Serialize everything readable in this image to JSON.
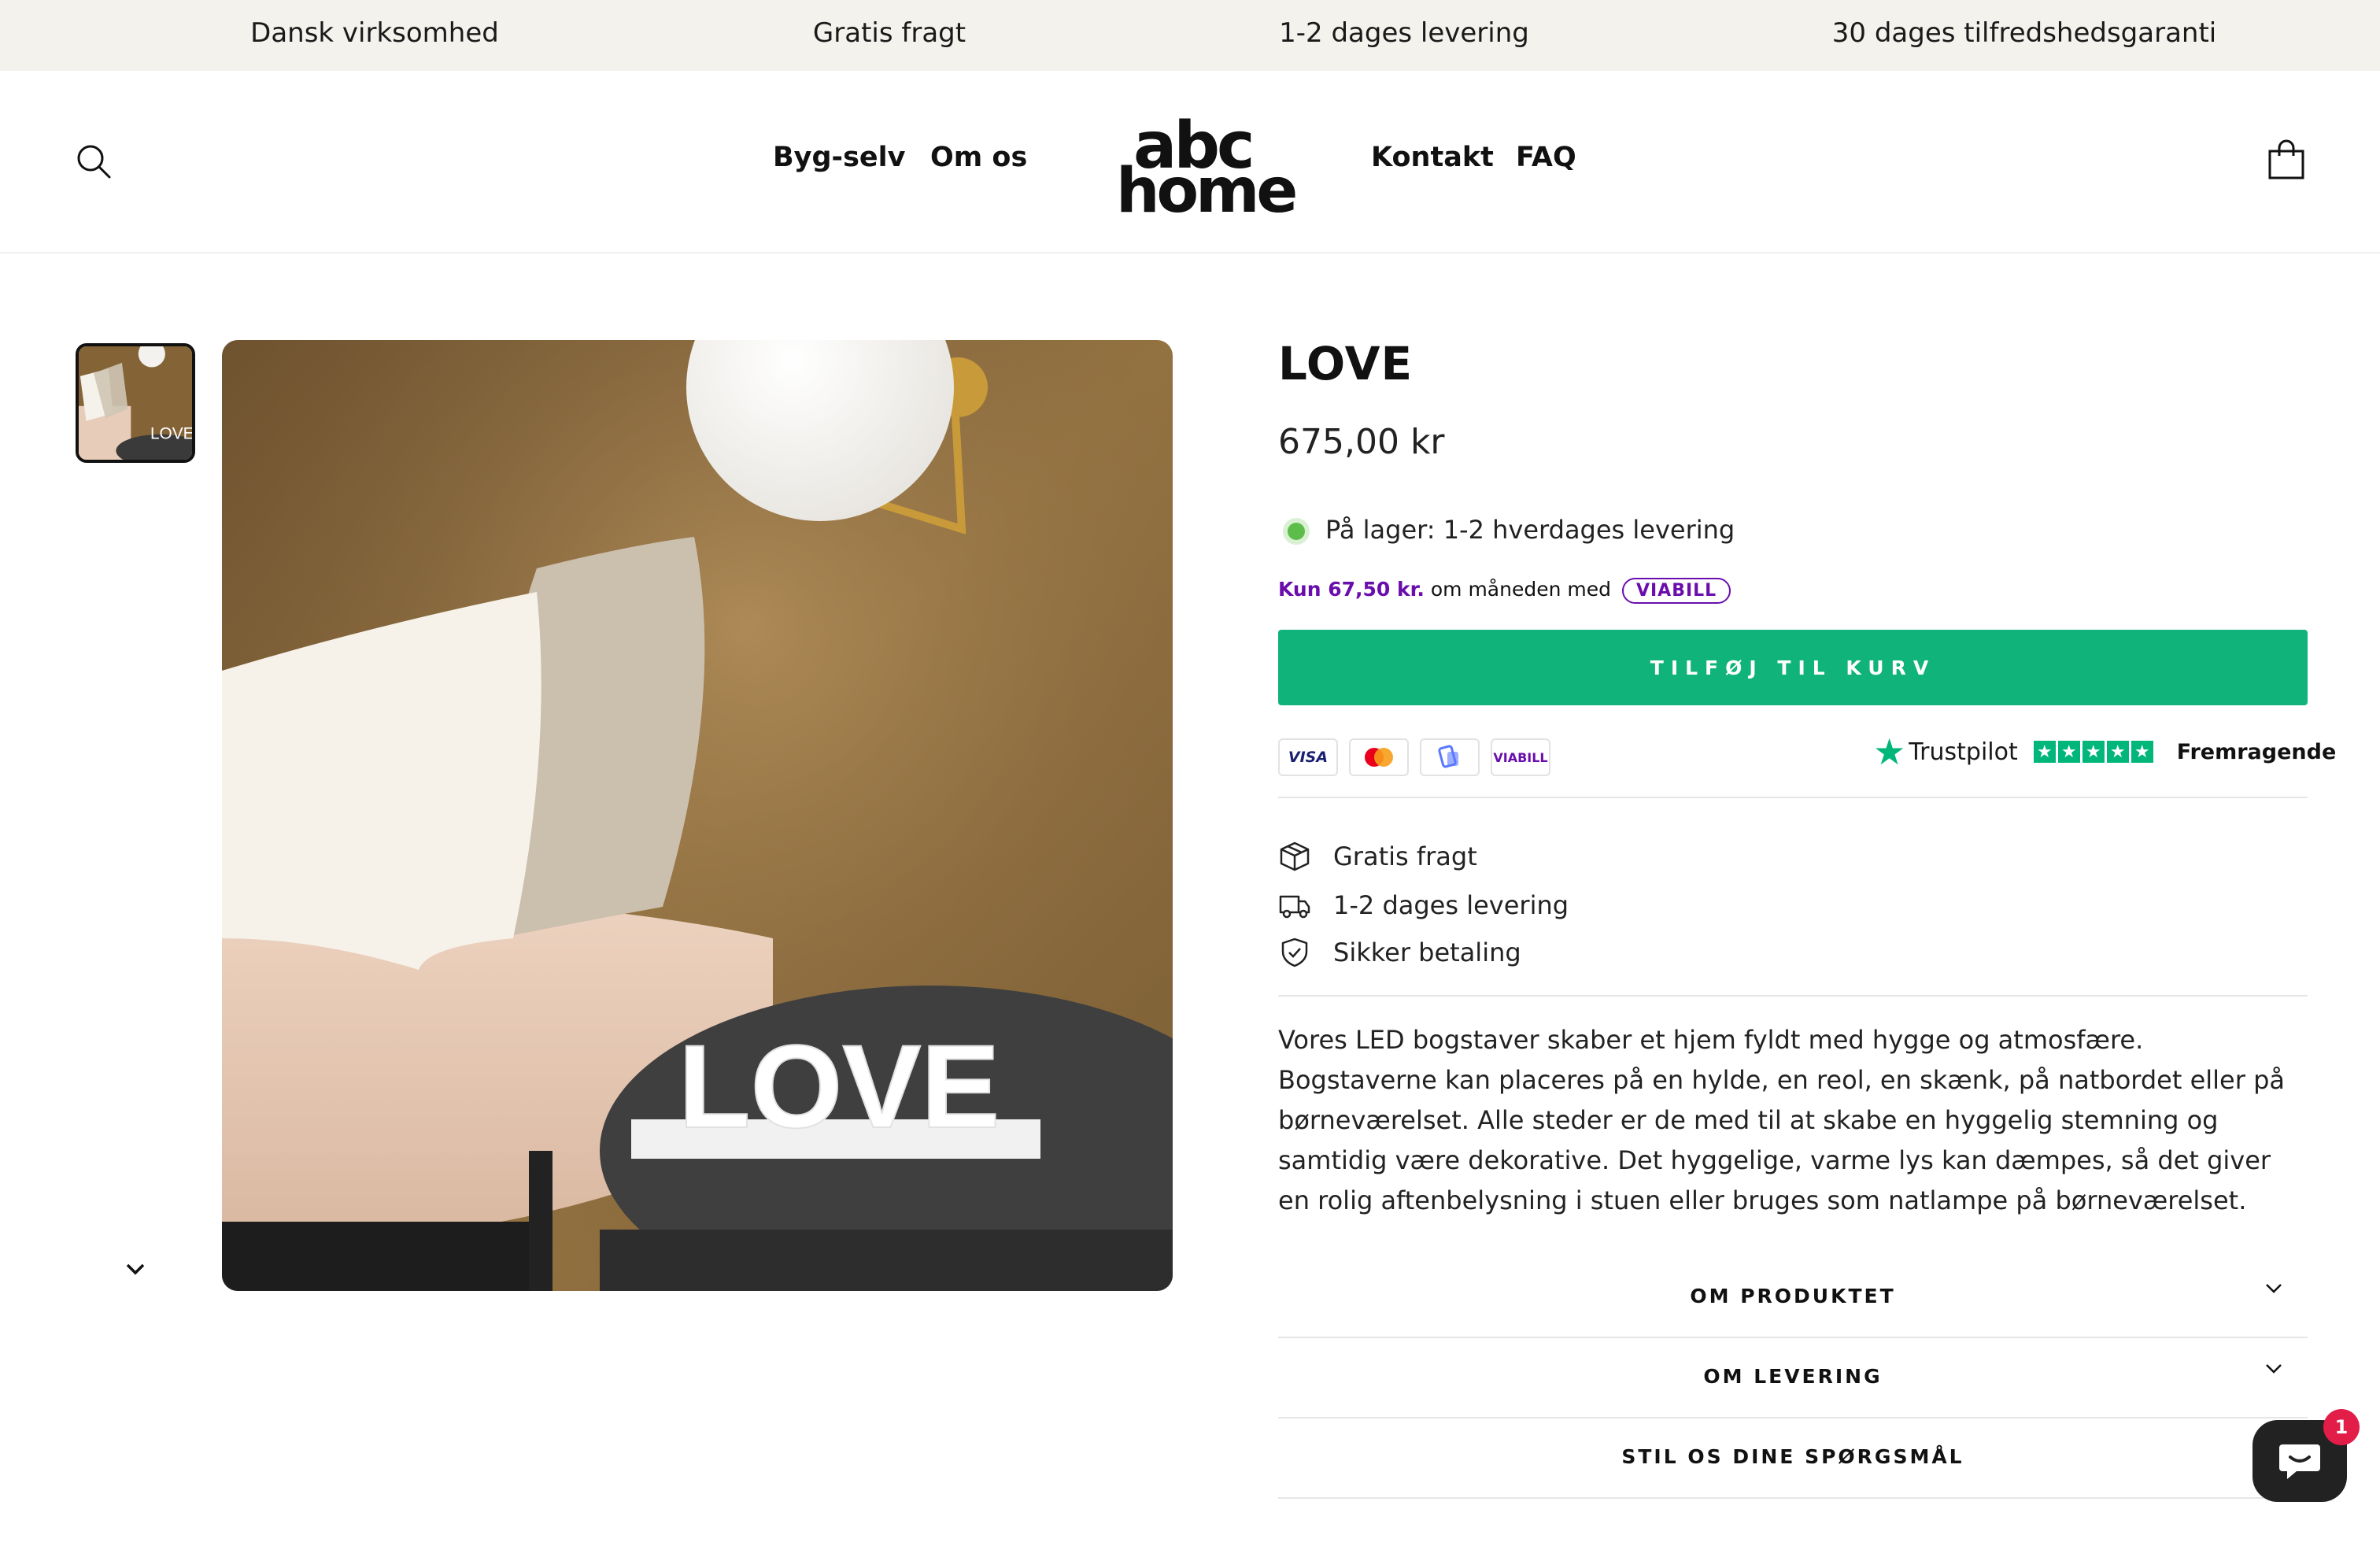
{
  "announcement": {
    "items": [
      "Dansk virksomhed",
      "Gratis fragt",
      "1-2 dages levering",
      "30 dages tilfredshedsgaranti"
    ]
  },
  "header": {
    "nav_left": [
      "Byg-selv",
      "Om os"
    ],
    "nav_right": [
      "Kontakt",
      "FAQ"
    ],
    "logo": {
      "line1": "abc",
      "line2": "home"
    }
  },
  "gallery": {
    "thumb_text": "LOVE",
    "image_text": "LOVE"
  },
  "product": {
    "title": "LOVE",
    "price": "675,00 kr",
    "stock": "På lager: 1-2 hverdages levering",
    "installment_amount": "Kun 67,50 kr.",
    "installment_text": "om måneden med",
    "viabill": "VIABILL",
    "add_to_cart": "TILFØJ TIL KURV",
    "payments": [
      "VISA",
      "mastercard",
      "mobilepay",
      "VIABILL"
    ],
    "trustpilot": {
      "name": "Trustpilot",
      "rating": "Fremragende",
      "stars": 5
    },
    "features": [
      "Gratis fragt",
      "1-2 dages levering",
      "Sikker betaling"
    ],
    "description": "Vores LED bogstaver skaber et hjem fyldt med hygge og atmosfære. Bogstaverne kan placeres på en hylde, en reol, en skænk, på natbordet eller på børneværelset. Alle steder er de med til at skabe en hyggelig stemning og samtidig være dekorative. Det hyggelige, varme lys kan dæmpes, så det giver en rolig aftenbelysning i stuen eller bruges som natlampe på børneværelset.",
    "accordions": [
      "OM PRODUKTET",
      "OM LEVERING",
      "STIL OS DINE SPØRGSMÅL"
    ]
  },
  "chat": {
    "badge": "1"
  },
  "colors": {
    "announce_bg": "#f3f2ed",
    "button": "#10b47a",
    "viabill": "#6a0dad",
    "trustpilot": "#00b67a",
    "stock": "#5cbd4a"
  }
}
